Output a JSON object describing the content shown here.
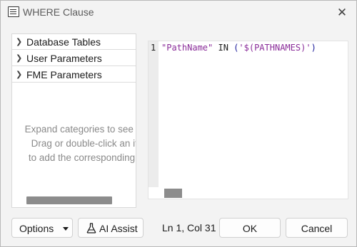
{
  "window": {
    "title": "WHERE Clause",
    "close_symbol": "✕"
  },
  "categories": [
    {
      "label": "Database Tables",
      "icon": "chevron-right-icon"
    },
    {
      "label": "User Parameters",
      "icon": "chevron-right-icon"
    },
    {
      "label": "FME Parameters",
      "icon": "chevron-right-icon"
    }
  ],
  "hint": {
    "line1": "Expand categories to see iter",
    "line2": "Drag or double-click an ite",
    "line3": "to add the corresponding te"
  },
  "editor": {
    "line_number": "1",
    "code_field": "\"PathName\"",
    "code_keyword": "IN",
    "code_open": "(",
    "code_param": "'$(PATHNAMES)'",
    "code_close": ")"
  },
  "buttons": {
    "options": "Options",
    "ai_assist": "AI Assist",
    "ok": "OK",
    "cancel": "Cancel"
  },
  "status": {
    "cursor_position": "Ln 1, Col 31"
  },
  "colors": {
    "string_token": "#8a2c99",
    "operator_token": "#1b1b9a"
  }
}
